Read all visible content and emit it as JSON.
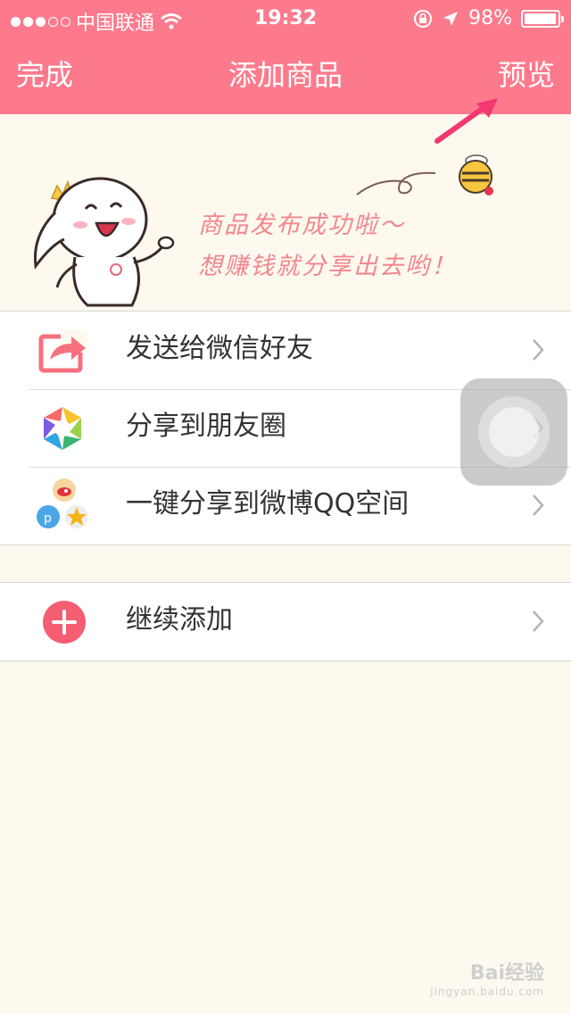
{
  "status_bar": {
    "carrier": "中国联通",
    "time": "19:32",
    "battery_pct": "98%",
    "battery_level": 0.98,
    "signal_filled": 3,
    "signal_total": 5
  },
  "nav": {
    "back_label": "完成",
    "title": "添加商品",
    "preview_label": "预览"
  },
  "banner": {
    "line1": "商品发布成功啦～",
    "line2": "想赚钱就分享出去哟！"
  },
  "share_list": [
    {
      "label": "发送给微信好友",
      "icon": "share-arrow-icon"
    },
    {
      "label": "分享到朋友圈",
      "icon": "moments-camera-icon"
    },
    {
      "label": "一键分享到微博QQ空间",
      "icon": "weibo-qzone-icon"
    }
  ],
  "add_list": [
    {
      "label": "继续添加",
      "icon": "add-circle-icon"
    }
  ],
  "watermark": {
    "brand": "Bai经验",
    "url": "jingyan.baidu.com"
  },
  "colors": {
    "header": "#fd7a8c",
    "background": "#fdf9ee",
    "accent_pink": "#f3868f"
  }
}
